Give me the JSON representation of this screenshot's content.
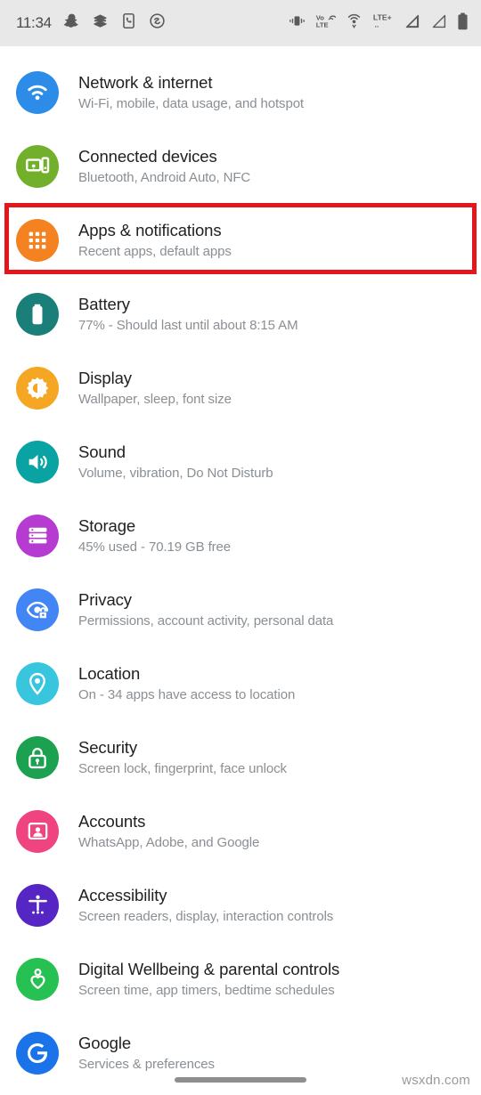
{
  "status_bar": {
    "clock": "11:34",
    "left_icons": [
      {
        "name": "snapchat-icon",
        "label": "Snapchat"
      },
      {
        "name": "delivery-icon",
        "label": "Delivery notification"
      },
      {
        "name": "phone-app-icon",
        "label": "Phone app"
      },
      {
        "name": "shazam-icon",
        "label": "Shazam"
      }
    ],
    "right_icons": [
      {
        "name": "vibrate-icon",
        "label": "Vibrate"
      },
      {
        "name": "volte-icon",
        "label": "VoLTE"
      },
      {
        "name": "hotspot-icon",
        "label": "Hotspot"
      },
      {
        "name": "lte-plus-icon",
        "label": "LTE+"
      },
      {
        "name": "signal-sim1-icon",
        "label": "Signal SIM 1"
      },
      {
        "name": "signal-sim2-icon",
        "label": "Signal SIM 2"
      },
      {
        "name": "battery-icon",
        "label": "Battery"
      }
    ],
    "volte_top": "VoLTE",
    "volte_bottom": "LTE",
    "lte_label": "LTE+",
    "background": "#e8e8e8"
  },
  "highlight": {
    "color": "#e3161c",
    "target": "Apps & notifications"
  },
  "settings": {
    "rows": [
      {
        "title": "Network & internet",
        "subtitle": "Wi-Fi, mobile, data usage, and hotspot",
        "icon": "wifi-icon",
        "color": "#2d8ce8"
      },
      {
        "title": "Connected devices",
        "subtitle": "Bluetooth, Android Auto, NFC",
        "icon": "cast-devices-icon",
        "color": "#72b02b"
      },
      {
        "title": "Apps & notifications",
        "subtitle": "Recent apps, default apps",
        "icon": "apps-grid-icon",
        "color": "#f58220"
      },
      {
        "title": "Battery",
        "subtitle": "77% - Should last until about 8:15 AM",
        "icon": "battery-icon",
        "color": "#1a7f78"
      },
      {
        "title": "Display",
        "subtitle": "Wallpaper, sleep, font size",
        "icon": "brightness-icon",
        "color": "#f5a623"
      },
      {
        "title": "Sound",
        "subtitle": "Volume, vibration, Do Not Disturb",
        "icon": "speaker-icon",
        "color": "#0aa3a3"
      },
      {
        "title": "Storage",
        "subtitle": "45% used - 70.19 GB free",
        "icon": "storage-icon",
        "color": "#b63bd1"
      },
      {
        "title": "Privacy",
        "subtitle": "Permissions, account activity, personal data",
        "icon": "privacy-eye-icon",
        "color": "#4285f4"
      },
      {
        "title": "Location",
        "subtitle": "On - 34 apps have access to location",
        "icon": "location-pin-icon",
        "color": "#37c6dd"
      },
      {
        "title": "Security",
        "subtitle": "Screen lock, fingerprint, face unlock",
        "icon": "lock-icon",
        "color": "#1ba14f"
      },
      {
        "title": "Accounts",
        "subtitle": "WhatsApp, Adobe, and Google",
        "icon": "account-card-icon",
        "color": "#ef447f"
      },
      {
        "title": "Accessibility",
        "subtitle": "Screen readers, display, interaction controls",
        "icon": "accessibility-icon",
        "color": "#5626c4"
      },
      {
        "title": "Digital Wellbeing & parental controls",
        "subtitle": "Screen time, app timers, bedtime schedules",
        "icon": "wellbeing-heart-icon",
        "color": "#27c052"
      },
      {
        "title": "Google",
        "subtitle": "Services & preferences",
        "icon": "google-g-icon",
        "color": "#1a73e8"
      }
    ]
  },
  "footer": {
    "watermark": "wsxdn.com",
    "nav_pill": "home-gesture-bar"
  }
}
